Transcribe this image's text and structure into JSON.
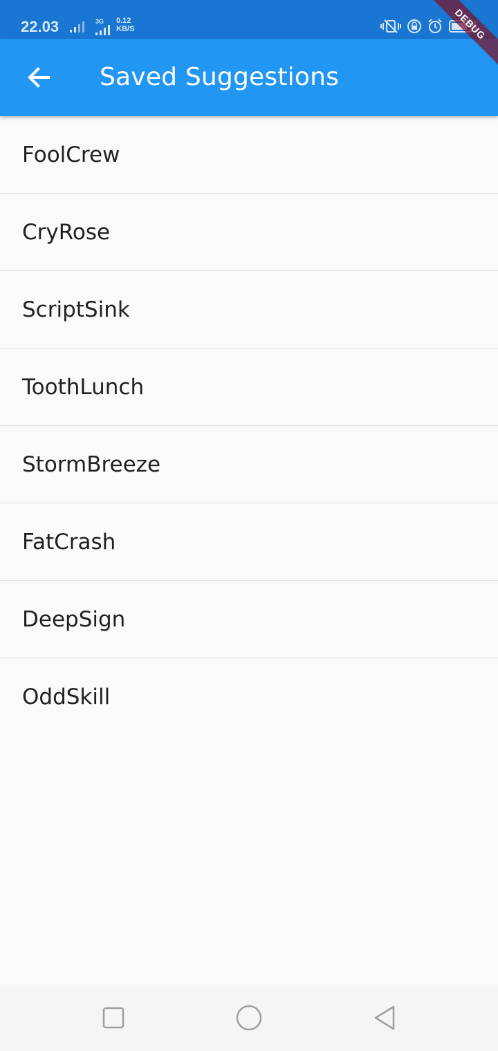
{
  "status_bar": {
    "time": "22.03",
    "network_type": "3G",
    "speed_value": "0.12",
    "speed_unit": "KB/S",
    "icons": [
      "signal-icon",
      "vibrate-icon",
      "rotation-lock-icon",
      "alarm-icon",
      "battery-icon"
    ]
  },
  "debug_banner": "DEBUG",
  "app_bar": {
    "back_icon": "arrow-back-icon",
    "title": "Saved Suggestions",
    "color": "#2196f3"
  },
  "saved_list": {
    "items": [
      {
        "label": "FoolCrew"
      },
      {
        "label": "CryRose"
      },
      {
        "label": "ScriptSink"
      },
      {
        "label": "ToothLunch"
      },
      {
        "label": "StormBreeze"
      },
      {
        "label": "FatCrash"
      },
      {
        "label": "DeepSign"
      },
      {
        "label": "OddSkill"
      }
    ]
  },
  "nav_bar": {
    "buttons": [
      "recents-icon",
      "home-icon",
      "back-triangle-icon"
    ]
  }
}
